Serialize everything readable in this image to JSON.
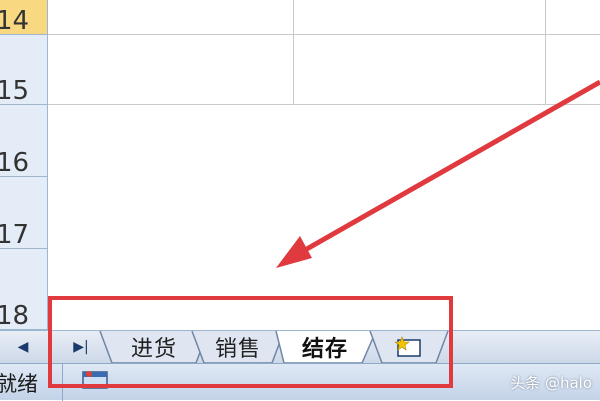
{
  "rows": [
    "14",
    "15",
    "16",
    "17",
    "18"
  ],
  "sheet_tabs": [
    "进货",
    "销售",
    "结存"
  ],
  "active_tab": "结存",
  "status": {
    "ready_text": "就绪"
  },
  "watermark": "头条 @halo",
  "colors": {
    "annotation_red": "#e0393e",
    "row_header": "#e4ecf7",
    "active_row_header": "#f8d880",
    "tabbar": "#cdd8e8"
  }
}
